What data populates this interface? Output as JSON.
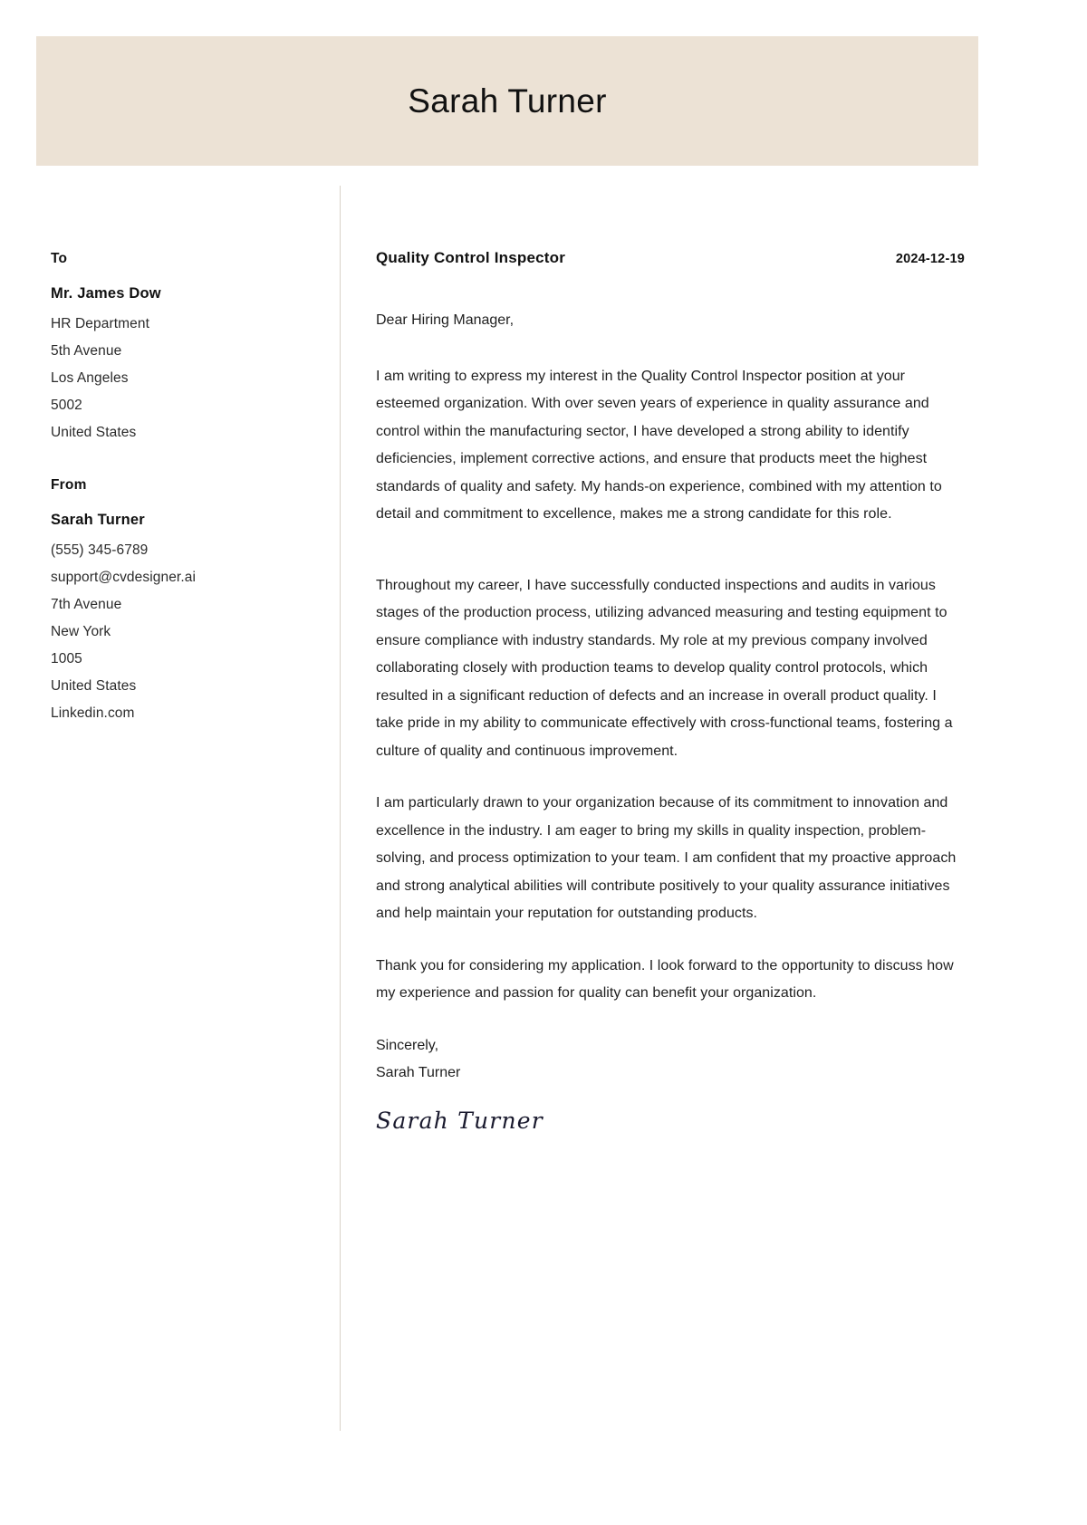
{
  "header": {
    "name": "Sarah Turner"
  },
  "sidebar": {
    "to": {
      "heading": "To",
      "name": "Mr. James Dow",
      "lines": [
        "HR Department",
        "5th Avenue",
        "Los Angeles",
        "5002",
        "United States"
      ]
    },
    "from": {
      "heading": "From",
      "name": "Sarah Turner",
      "lines": [
        "(555) 345-6789",
        "support@cvdesigner.ai",
        "7th Avenue",
        "New York",
        "1005",
        "United States",
        "Linkedin.com"
      ]
    }
  },
  "letter": {
    "title": "Quality Control Inspector",
    "date": "2024-12-19",
    "salutation": "Dear Hiring Manager,",
    "paragraphs": [
      "I am writing to express my interest in the Quality Control Inspector position at your esteemed organization. With over seven years of experience in quality assurance and control within the manufacturing sector, I have developed a strong ability to identify deficiencies, implement corrective actions, and ensure that products meet the highest standards of quality and safety. My hands-on experience, combined with my attention to detail and commitment to excellence, makes me a strong candidate for this role.",
      "Throughout my career, I have successfully conducted inspections and audits in various stages of the production process, utilizing advanced measuring and testing equipment to ensure compliance with industry standards. My role at my previous company involved collaborating closely with production teams to develop quality control protocols, which resulted in a significant reduction of defects and an increase in overall product quality. I take pride in my ability to communicate effectively with cross-functional teams, fostering a culture of quality and continuous improvement.",
      "I am particularly drawn to your organization because of its commitment to innovation and excellence in the industry. I am eager to bring my skills in quality inspection, problem-solving, and process optimization to your team. I am confident that my proactive approach and strong analytical abilities will contribute positively to your quality assurance initiatives and help maintain your reputation for outstanding products.",
      "Thank you for considering my application. I look forward to the opportunity to discuss how my experience and passion for quality can benefit your organization."
    ],
    "closing": "Sincerely,",
    "closing_name": "Sarah Turner",
    "signature": "Sarah Turner"
  },
  "colors": {
    "banner": "#ece2d5",
    "text": "#1f1f1f",
    "divider": "#d9d2c8"
  }
}
